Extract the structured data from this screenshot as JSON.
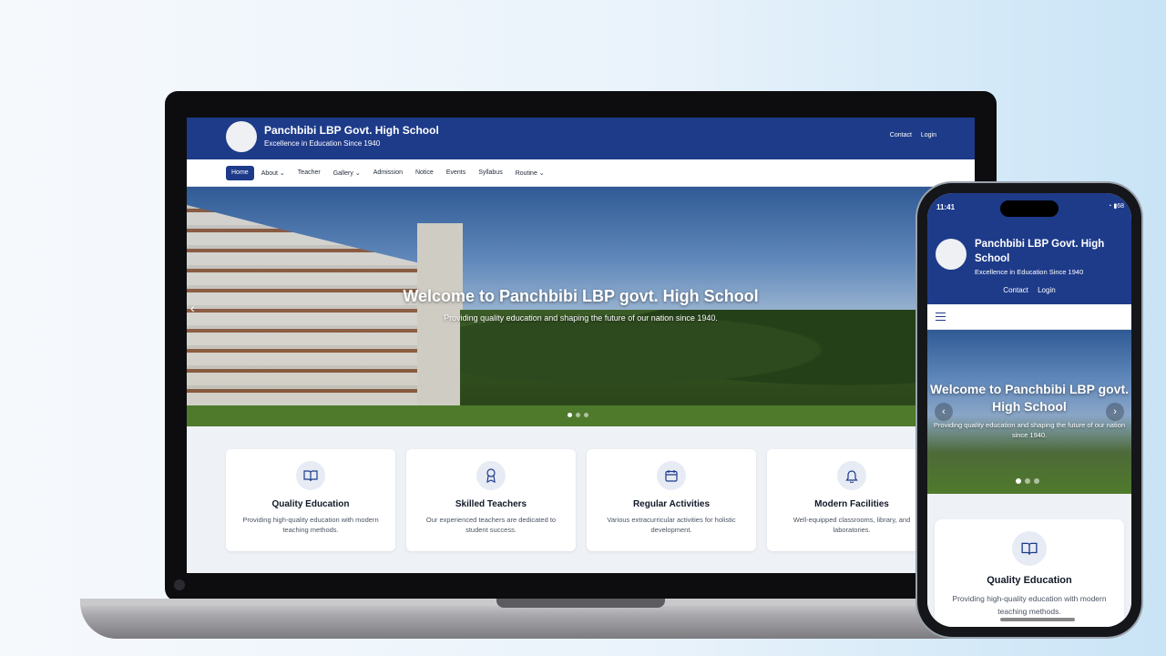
{
  "site": {
    "title": "Panchbibi LBP Govt. High School",
    "tagline": "Excellence in Education Since 1940",
    "header_links": [
      "Contact",
      "Login"
    ]
  },
  "nav": {
    "items": [
      {
        "label": "Home",
        "active": true
      },
      {
        "label": "About ⌄"
      },
      {
        "label": "Teacher"
      },
      {
        "label": "Gallery ⌄"
      },
      {
        "label": "Admission"
      },
      {
        "label": "Notice"
      },
      {
        "label": "Events"
      },
      {
        "label": "Syllabus"
      },
      {
        "label": "Routine ⌄"
      }
    ]
  },
  "hero": {
    "title": "Welcome to Panchbibi LBP govt. High School",
    "subtitle": "Providing quality education and shaping the future of our nation since 1940.",
    "slide_count": 3,
    "active_slide": 1
  },
  "features": [
    {
      "title": "Quality Education",
      "text": "Providing high-quality education with modern teaching methods.",
      "icon": "book-icon"
    },
    {
      "title": "Skilled Teachers",
      "text": "Our experienced teachers are dedicated to student success.",
      "icon": "award-icon"
    },
    {
      "title": "Regular Activities",
      "text": "Various extracurricular activities for holistic development.",
      "icon": "calendar-icon"
    },
    {
      "title": "Modern Facilities",
      "text": "Well-equipped classrooms, library, and laboratories.",
      "icon": "bell-icon"
    }
  ],
  "phone": {
    "status_time": "11:41",
    "battery": "68",
    "hero_title": "Welcome to Panchbibi LBP govt. High School",
    "hero_subtitle": "Providing quality education and shaping the future of our nation since 1940.",
    "card_title": "Quality Education",
    "card_text": "Providing high-quality education with modern teaching methods."
  },
  "colors": {
    "brand": "#1e3b8a",
    "feature_bg": "#eef1f6"
  }
}
